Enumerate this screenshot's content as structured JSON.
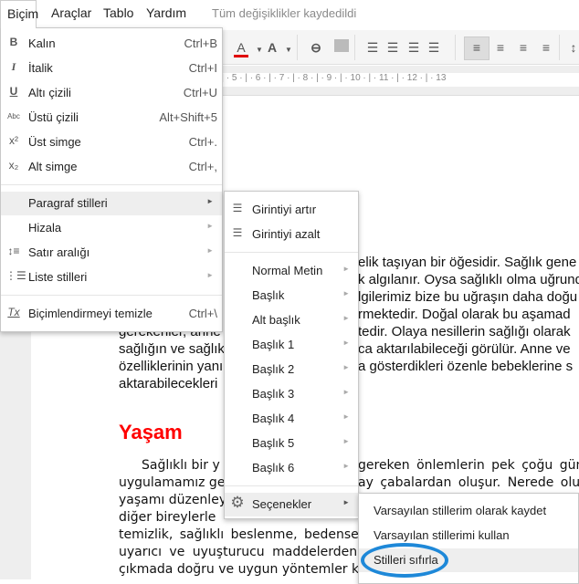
{
  "menubar": {
    "items": [
      "Biçim",
      "Araçlar",
      "Tablo",
      "Yardım"
    ],
    "status": "Tüm değişiklikler kaydedildi"
  },
  "toolbar": {
    "font_color_label": "A",
    "highlight_label": "A",
    "text_color": "#e00000",
    "ruler": "3 · | · 4 · | · 5 · | · 6 · | · 7 · | · 8 · | · 9 · | · 10 · | · 11 · | · 12 · | · 13"
  },
  "format_menu": {
    "items": [
      {
        "icon": "bold-icon",
        "glyph": "B",
        "label": "Kalın",
        "shortcut": "Ctrl+B"
      },
      {
        "icon": "italic-icon",
        "glyph": "I",
        "label": "İtalik",
        "shortcut": "Ctrl+I"
      },
      {
        "icon": "underline-icon",
        "glyph": "U",
        "label": "Altı çizili",
        "shortcut": "Ctrl+U"
      },
      {
        "icon": "strikethrough-icon",
        "glyph": "Abc",
        "label": "Üstü çizili",
        "shortcut": "Alt+Shift+5"
      },
      {
        "icon": "superscript-icon",
        "glyph": "x²",
        "label": "Üst simge",
        "shortcut": "Ctrl+."
      },
      {
        "icon": "subscript-icon",
        "glyph": "x₂",
        "label": "Alt simge",
        "shortcut": "Ctrl+,"
      }
    ],
    "submenus": [
      {
        "label": "Paragraf stilleri"
      },
      {
        "label": "Hizala"
      },
      {
        "icon": "line-spacing-icon",
        "glyph": "↕≡",
        "label": "Satır aralığı"
      },
      {
        "icon": "list-styles-icon",
        "glyph": "⋮☰",
        "label": "Liste stilleri"
      }
    ],
    "clear": {
      "icon": "clear-formatting-icon",
      "glyph": "Tx",
      "label": "Biçimlendirmeyi temizle",
      "shortcut": "Ctrl+\\"
    }
  },
  "paragraph_styles_menu": {
    "indent": [
      "Girintiyi artır",
      "Girintiyi azalt"
    ],
    "styles": [
      "Normal Metin",
      "Başlık",
      "Alt başlık",
      "Başlık 1",
      "Başlık 2",
      "Başlık 3",
      "Başlık 4",
      "Başlık 5",
      "Başlık 6"
    ],
    "options": "Seçenekler"
  },
  "options_menu": {
    "items": [
      "Varsayılan stillerim olarak kaydet",
      "Varsayılan stillerimi kullan",
      "Stilleri sıfırla"
    ]
  },
  "document": {
    "para1_right": [
      "elik taşıyan bir öğesidir. Sağlık gene",
      "k algılanır. Oysa sağlıklı olma uğrund",
      "lgilerimiz bize bu uğraşın daha doğu",
      "rmektedir. Doğal olarak bu aşamad",
      "tedir. Olaya nesillerin sağlığı olarak",
      "ca aktarılabileceği görülür. Anne ve",
      "a gösterdikleri özenle bebeklerine s"
    ],
    "para1_left": [
      "gerekenler, anne",
      "sağlığın ve sağlık",
      "özelliklerinin yanı",
      "aktarabilecekleri"
    ],
    "heading": "Yaşam",
    "para2_left": [
      "Sağlıklı bir y",
      "uygulamamız ge",
      "yaşamı düzenley",
      "diğer bireylerle",
      "temizlik, sağlıklı beslenme, bedense",
      "uyarıcı ve uyuşturucu maddelerden",
      "çıkmada doğru ve uygun yöntemler k"
    ],
    "para2_right": [
      "gereken önlemlerin pek çoğu gün",
      "ay çabalardan oluşur. Nerede olu"
    ]
  }
}
